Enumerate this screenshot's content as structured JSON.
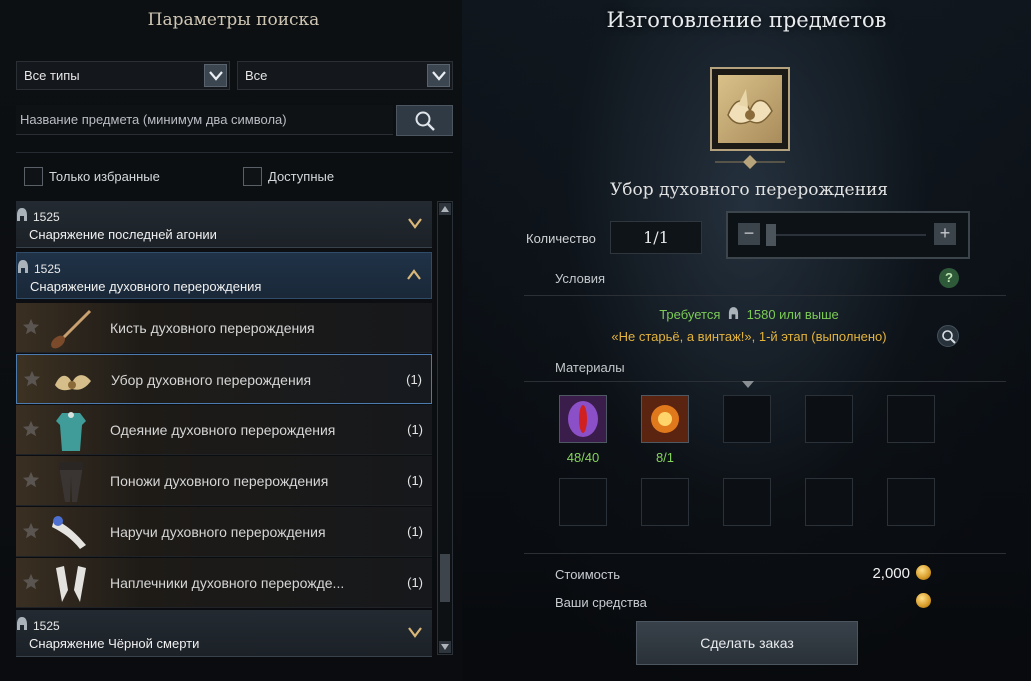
{
  "search_panel": {
    "title": "Параметры поиска",
    "type_filter": "Все типы",
    "sub_filter": "Все",
    "name_placeholder": "Название предмета (минимум два символа)",
    "favorites_only_label": "Только избранные",
    "available_label": "Доступные",
    "favorites_only_checked": false,
    "available_checked": false
  },
  "list": {
    "categories": [
      {
        "level": "1525",
        "name": "Снаряжение последней агонии",
        "expanded": false
      },
      {
        "level": "1525",
        "name": "Снаряжение духовного перерождения",
        "expanded": true
      },
      {
        "level": "1525",
        "name": "Снаряжение Чёрной смерти",
        "expanded": false
      }
    ],
    "items": [
      {
        "name": "Кисть духовного перерождения",
        "count": "",
        "icon": "brush-icon"
      },
      {
        "name": "Убор духовного перерождения",
        "count": "(1)",
        "icon": "headgear-icon",
        "selected": true
      },
      {
        "name": "Одеяние духовного перерождения",
        "count": "(1)",
        "icon": "outfit-icon"
      },
      {
        "name": "Поножи духовного перерождения",
        "count": "(1)",
        "icon": "leggings-icon"
      },
      {
        "name": "Наручи духовного перерождения",
        "count": "(1)",
        "icon": "bracers-icon"
      },
      {
        "name": "Наплечники духовного перерожде...",
        "count": "(1)",
        "icon": "shoulders-icon"
      }
    ]
  },
  "craft": {
    "title": "Изготовление предметов",
    "item_name": "Убор духовного перерождения",
    "quantity_label": "Количество",
    "quantity_value": "1/1",
    "conditions_label": "Условия",
    "requirement_prefix": "Требуется",
    "requirement_level": "1580 или выше",
    "requirement_quest": "«Не старьё, а винтаж!», 1-й этап (выполнено)",
    "materials_label": "Материалы",
    "materials": [
      {
        "icon": "purple-eye-material-icon",
        "count": "48/40"
      },
      {
        "icon": "fire-orb-material-icon",
        "count": "8/1"
      }
    ],
    "empty_slots": 8,
    "cost_label": "Стоимость",
    "cost_value": "2,000",
    "funds_label": "Ваши средства",
    "funds_value": "",
    "order_button": "Сделать заказ"
  },
  "colors": {
    "requirement_green": "#7ccb55",
    "quest_gold": "#e3b33b",
    "selected_border": "#4d7bb0"
  }
}
